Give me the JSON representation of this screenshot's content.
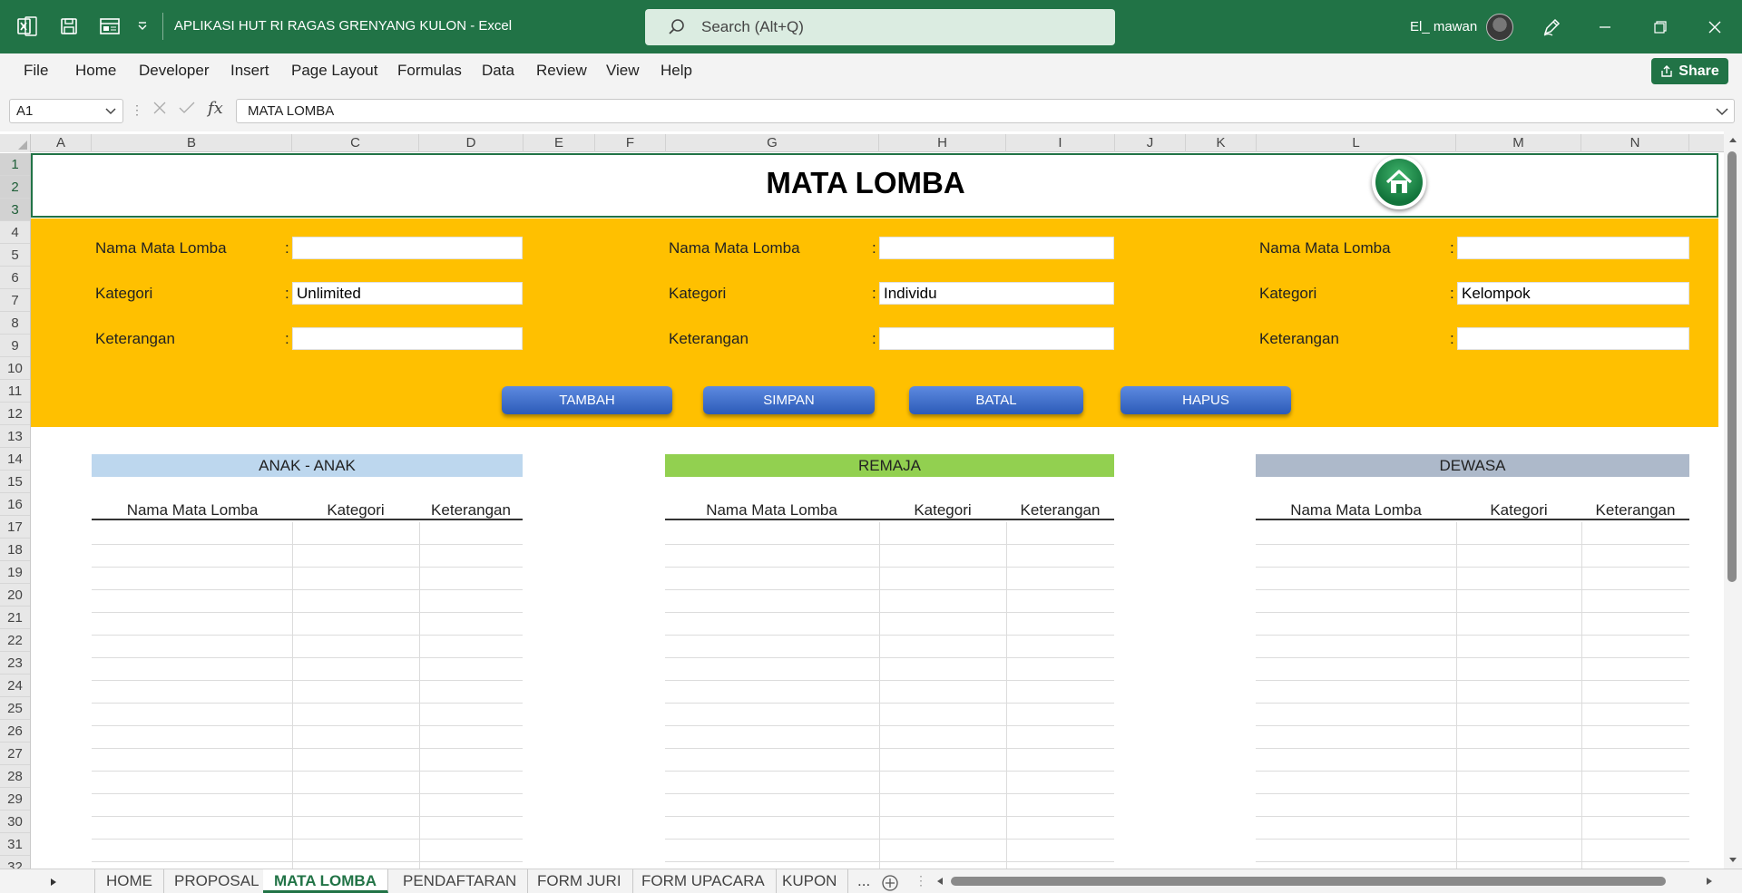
{
  "window": {
    "title": "APLIKASI HUT RI RAGAS GRENYANG KULON  -  Excel",
    "search_placeholder": "Search (Alt+Q)",
    "user": "El_ mawan"
  },
  "menu": [
    "File",
    "Home",
    "Developer",
    "Insert",
    "Page Layout",
    "Formulas",
    "Data",
    "Review",
    "View",
    "Help"
  ],
  "share_label": "Share",
  "formula_bar": {
    "cell_ref": "A1",
    "content": "MATA LOMBA",
    "fx": "fx"
  },
  "columns": [
    "A",
    "B",
    "C",
    "D",
    "E",
    "F",
    "G",
    "H",
    "I",
    "J",
    "K",
    "L",
    "M",
    "N"
  ],
  "rows": [
    "1",
    "2",
    "3",
    "4",
    "5",
    "6",
    "7",
    "8",
    "9",
    "10",
    "11",
    "12",
    "13",
    "14",
    "15",
    "16",
    "17",
    "18",
    "19",
    "20",
    "21",
    "22",
    "23",
    "24",
    "25",
    "26",
    "27",
    "28",
    "29",
    "30",
    "31",
    "32"
  ],
  "sheet": {
    "title": "MATA LOMBA",
    "forms": [
      {
        "label_name": "Nama Mata Lomba",
        "label_category": "Kategori",
        "label_note": "Keterangan",
        "colon": ":",
        "name_value": "",
        "category_value": "Unlimited",
        "note_value": ""
      },
      {
        "label_name": "Nama Mata Lomba",
        "label_category": "Kategori",
        "label_note": "Keterangan",
        "colon": ":",
        "name_value": "",
        "category_value": "Individu",
        "note_value": ""
      },
      {
        "label_name": "Nama Mata Lomba",
        "label_category": "Kategori",
        "label_note": "Keterangan",
        "colon": ":",
        "name_value": "",
        "category_value": "Kelompok",
        "note_value": ""
      }
    ],
    "buttons": [
      "TAMBAH",
      "SIMPAN",
      "BATAL",
      "HAPUS"
    ],
    "sections": [
      {
        "title": "ANAK - ANAK",
        "color": "#bdd7ee"
      },
      {
        "title": "REMAJA",
        "color": "#92d050"
      },
      {
        "title": "DEWASA",
        "color": "#adb9ca"
      }
    ],
    "table_headers": [
      "Nama Mata Lomba",
      "Kategori",
      "Keterangan"
    ]
  },
  "tabs": [
    "HOME",
    "PROPOSAL",
    "MATA LOMBA",
    "PENDAFTARAN",
    "FORM JURI",
    "FORM UPACARA",
    "KUPON",
    "..."
  ],
  "active_tab": "MATA LOMBA",
  "colors": {
    "excel_green": "#217346",
    "form_band": "#ffc000",
    "button_blue": "#2c5bb8"
  }
}
